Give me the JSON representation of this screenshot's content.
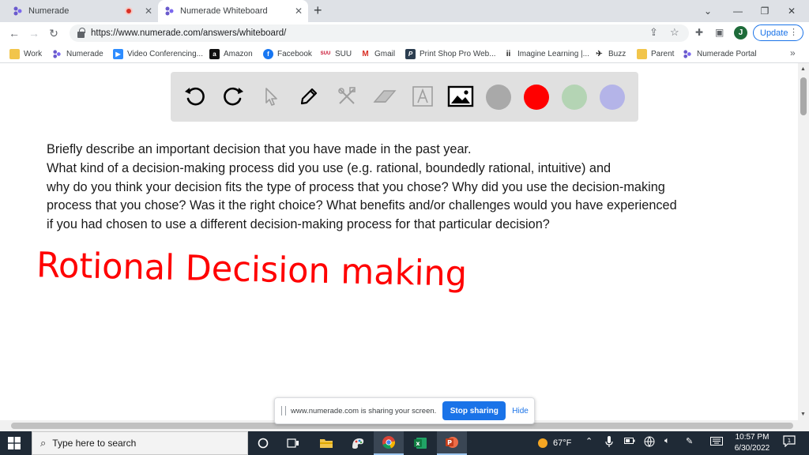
{
  "tabs": [
    {
      "title": "Numerade",
      "active": false,
      "recording": true
    },
    {
      "title": "Numerade Whiteboard",
      "active": true,
      "recording": false
    }
  ],
  "address": {
    "url": "https://www.numerade.com/answers/whiteboard/"
  },
  "profile": {
    "initial": "J"
  },
  "update_label": "Update",
  "bookmarks": [
    {
      "label": "Work",
      "icon": "folder-icon"
    },
    {
      "label": "Numerade",
      "icon": "numerade-icon"
    },
    {
      "label": "Video Conferencing...",
      "icon": "video-icon"
    },
    {
      "label": "Amazon",
      "icon": "amazon-icon"
    },
    {
      "label": "Facebook",
      "icon": "facebook-icon"
    },
    {
      "label": "SUU",
      "icon": "suu-icon"
    },
    {
      "label": "Gmail",
      "icon": "gmail-icon"
    },
    {
      "label": "Print Shop Pro Web...",
      "icon": "printshop-icon"
    },
    {
      "label": "Imagine Learning |...",
      "icon": "imagine-icon"
    },
    {
      "label": "Buzz",
      "icon": "buzz-icon"
    },
    {
      "label": "Parent",
      "icon": "folder-icon"
    },
    {
      "label": "Numerade Portal",
      "icon": "numerade-icon"
    }
  ],
  "whiteboard": {
    "tools": [
      "undo-icon",
      "redo-icon",
      "pointer-icon",
      "pen-icon",
      "tools-icon",
      "eraser-icon",
      "text-icon",
      "image-icon"
    ],
    "colors": [
      "#a9a9a9",
      "#ff0000",
      "#b4d4b4",
      "#b4b4e8"
    ],
    "question_lines": [
      "Briefly describe an important decision that you have made in the past year.",
      "What kind of a decision-making process did you use (e.g. rational, boundedly rational, intuitive) and",
      "why do you think your decision fits the type of process that you chose? Why did you use the decision-making",
      "process that you chose? Was it the right choice? What benefits and/or challenges would you have experienced",
      "if you had chosen to use a different decision-making process for that particular decision?"
    ],
    "handwritten_note": "Rotional Decision making",
    "ink_color": "#ff0000"
  },
  "share_banner": {
    "message": "www.numerade.com is sharing your screen.",
    "stop_label": "Stop sharing",
    "hide_label": "Hide"
  },
  "taskbar": {
    "search_placeholder": "Type here to search",
    "weather": "67°F",
    "time": "10:57 PM",
    "date": "6/30/2022",
    "notification_count": "1"
  }
}
